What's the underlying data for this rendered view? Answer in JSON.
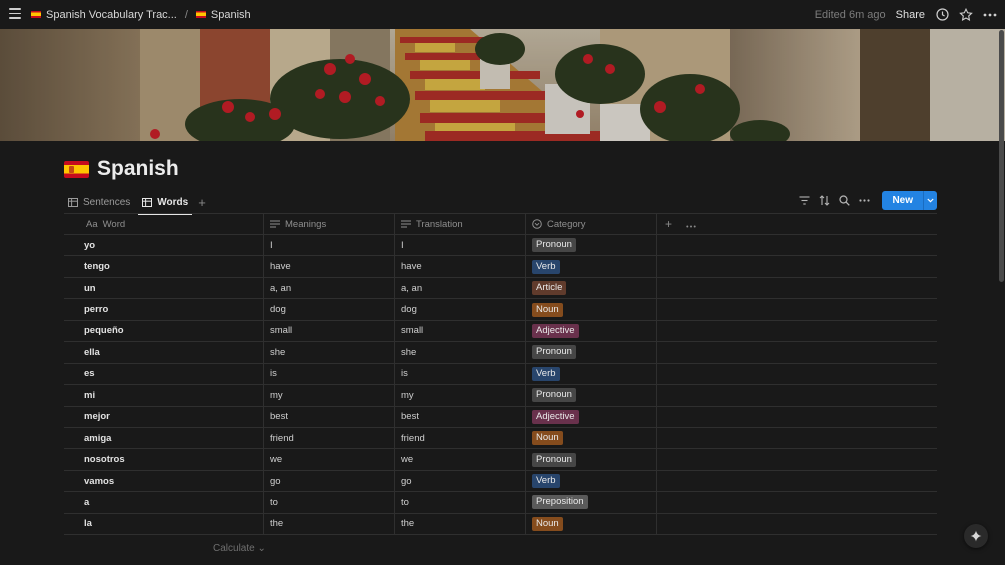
{
  "topbar": {
    "breadcrumbs": [
      {
        "label": "Spanish Vocabulary Trac...",
        "flag": "es-flag"
      },
      {
        "label": "Spanish",
        "flag": "es-flag"
      }
    ],
    "separator": "/",
    "edited": "Edited 6m ago",
    "share": "Share",
    "icons": [
      "menu-icon",
      "clock-icon",
      "star-icon",
      "more-icon"
    ]
  },
  "page": {
    "title": "Spanish",
    "icon": "spain-flag"
  },
  "views": {
    "tabs": [
      {
        "label": "Sentences",
        "icon": "table-icon",
        "active": false
      },
      {
        "label": "Words",
        "icon": "table-icon",
        "active": true
      }
    ],
    "add": "+"
  },
  "toolbar": {
    "icons": [
      "filter-icon",
      "sort-icon",
      "search-icon",
      "more-icon"
    ],
    "new_label": "New"
  },
  "table": {
    "columns": [
      {
        "label": "Word",
        "prefix": "Aa"
      },
      {
        "label": "Meanings",
        "icon": "text-icon"
      },
      {
        "label": "Translation",
        "icon": "text-icon"
      },
      {
        "label": "Category",
        "icon": "select-icon"
      }
    ],
    "rows": [
      {
        "word": "yo",
        "meaning": "I",
        "translation": "I",
        "category": "Pronoun"
      },
      {
        "word": "tengo",
        "meaning": "have",
        "translation": "have",
        "category": "Verb"
      },
      {
        "word": "un",
        "meaning": "a, an",
        "translation": "a, an",
        "category": "Article"
      },
      {
        "word": "perro",
        "meaning": "dog",
        "translation": "dog",
        "category": "Noun"
      },
      {
        "word": "pequeño",
        "meaning": "small",
        "translation": "small",
        "category": "Adjective"
      },
      {
        "word": "ella",
        "meaning": "she",
        "translation": "she",
        "category": "Pronoun"
      },
      {
        "word": "es",
        "meaning": "is",
        "translation": "is",
        "category": "Verb"
      },
      {
        "word": "mi",
        "meaning": "my",
        "translation": "my",
        "category": "Pronoun"
      },
      {
        "word": "mejor",
        "meaning": "best",
        "translation": "best",
        "category": "Adjective"
      },
      {
        "word": "amiga",
        "meaning": "friend",
        "translation": "friend",
        "category": "Noun"
      },
      {
        "word": "nosotros",
        "meaning": "we",
        "translation": "we",
        "category": "Pronoun"
      },
      {
        "word": "vamos",
        "meaning": "go",
        "translation": "go",
        "category": "Verb"
      },
      {
        "word": "a",
        "meaning": "to",
        "translation": "to",
        "category": "Preposition"
      },
      {
        "word": "la",
        "meaning": "the",
        "translation": "the",
        "category": "Noun"
      }
    ],
    "calculate": "Calculate"
  },
  "tag_colors": {
    "Pronoun": "#464646",
    "Verb": "#28456c",
    "Article": "#603b2c",
    "Noun": "#854c1d",
    "Adjective": "#69314c",
    "Preposition": "#5a5a5a"
  },
  "colors": {
    "background": "#191919",
    "accent": "#2383e2"
  }
}
